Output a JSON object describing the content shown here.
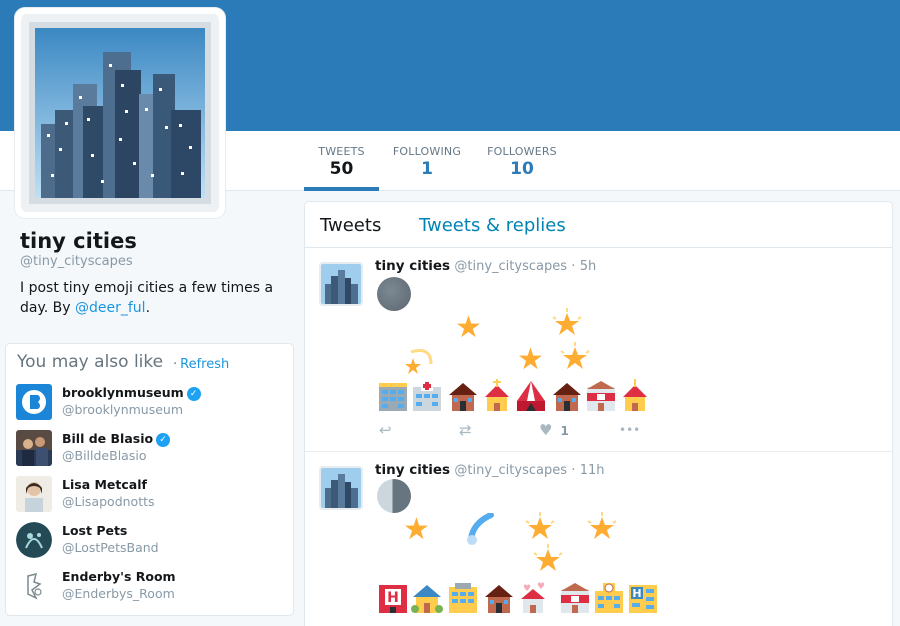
{
  "profile": {
    "name": "tiny cities",
    "handle": "@tiny_cityscapes",
    "bio_prefix": "I post tiny emoji cities a few times a day. By ",
    "bio_link": "@deer_ful",
    "bio_suffix": "."
  },
  "nav": {
    "items": [
      {
        "label": "TWEETS",
        "value": "50"
      },
      {
        "label": "FOLLOWING",
        "value": "1"
      },
      {
        "label": "FOLLOWERS",
        "value": "10"
      }
    ]
  },
  "who_to_follow": {
    "title": "You may also like",
    "separator": "·",
    "refresh": "Refresh",
    "users": [
      {
        "name": "brooklynmuseum",
        "handle": "@brooklynmuseum",
        "verified": true
      },
      {
        "name": "Bill de Blasio",
        "handle": "@BilldeBlasio",
        "verified": true
      },
      {
        "name": "Lisa Metcalf",
        "handle": "@Lisapodnotts",
        "verified": false
      },
      {
        "name": "Lost Pets",
        "handle": "@LostPetsBand",
        "verified": false
      },
      {
        "name": "Enderby's Room",
        "handle": "@Enderbys_Room",
        "verified": false
      }
    ],
    "verified_glyph": "✓"
  },
  "timeline": {
    "tabs": [
      "Tweets",
      "Tweets & replies"
    ],
    "tweets": [
      {
        "name": "tiny cities",
        "handle": "@tiny_cityscapes",
        "separator": "·",
        "time": "5h",
        "likes": "1"
      },
      {
        "name": "tiny cities",
        "handle": "@tiny_cityscapes",
        "separator": "·",
        "time": "11h",
        "likes": ""
      }
    ]
  },
  "icons": {
    "reply": "reply-icon",
    "retweet": "retweet-icon",
    "like": "heart-icon",
    "more": "more-icon",
    "star_glyph": "★",
    "reply_glyph": "↩",
    "retweet_glyph": "⇄",
    "like_glyph": "♥",
    "more_glyph": "•••"
  },
  "colors": {
    "banner": "#2b7bb9",
    "link": "#1b95e0",
    "accent": "#2b7bb9",
    "star": "#ffac33"
  }
}
